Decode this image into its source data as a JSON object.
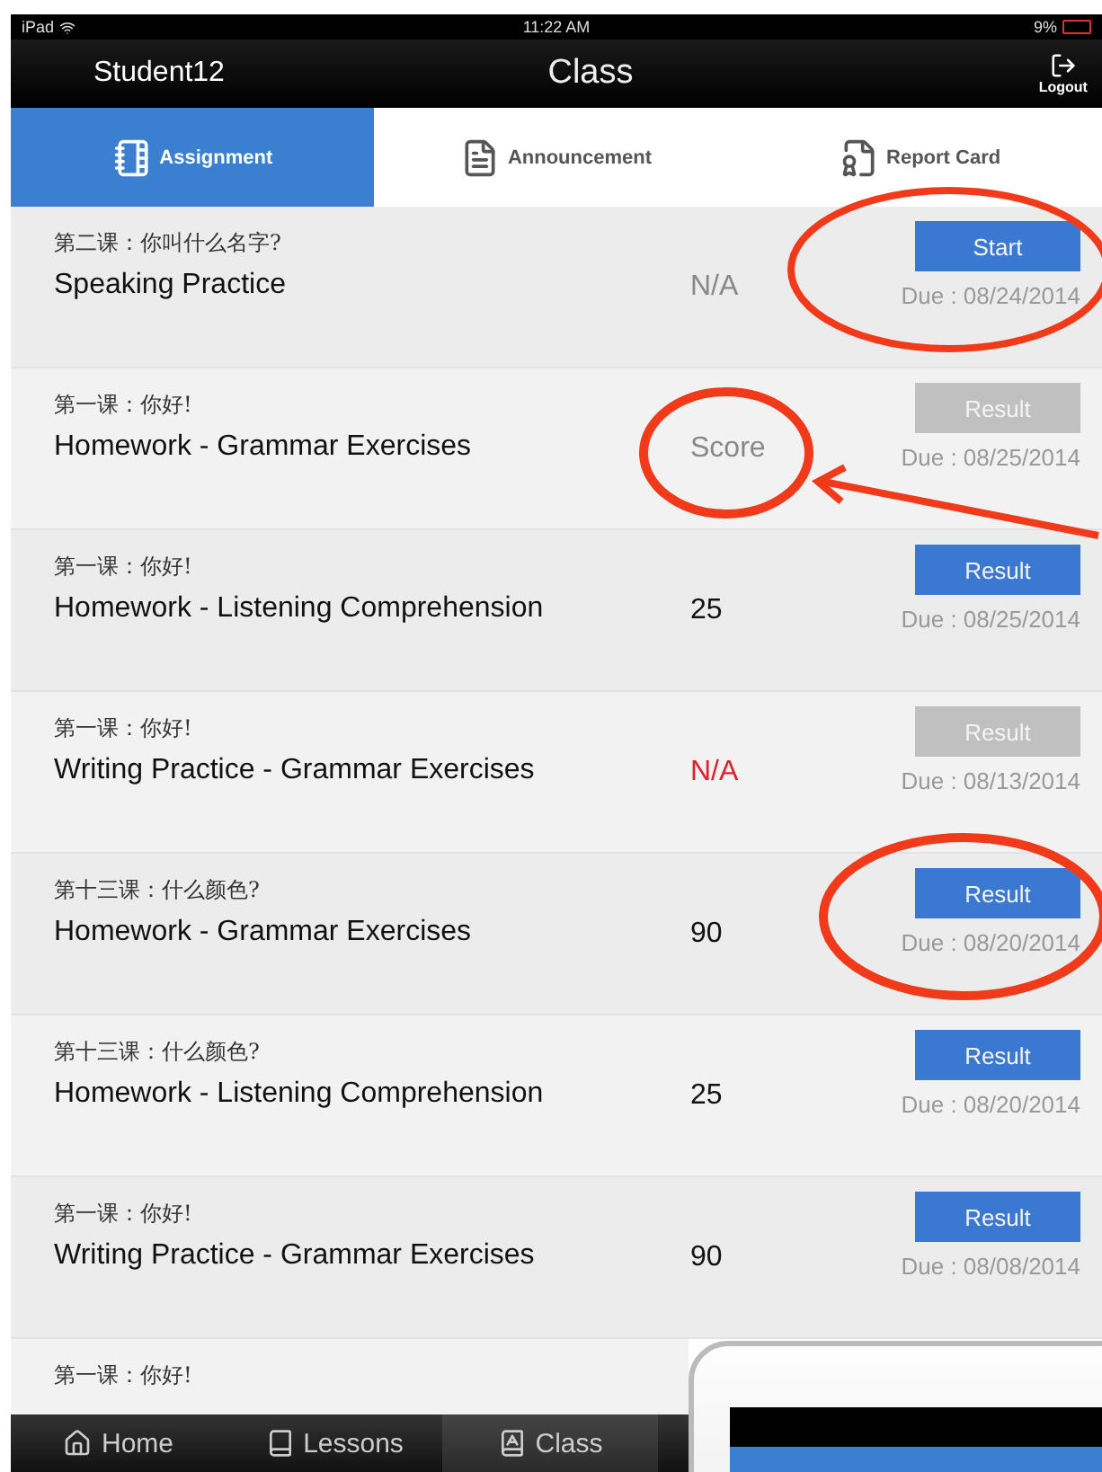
{
  "status_bar": {
    "device": "iPad",
    "time": "11:22 AM",
    "battery": "9%"
  },
  "nav_bar": {
    "user": "Student12",
    "title": "Class",
    "logout": "Logout"
  },
  "tabs": [
    {
      "label": "Assignment",
      "selected": true,
      "kind": "notebook"
    },
    {
      "label": "Announcement",
      "selected": false,
      "kind": "document"
    },
    {
      "label": "Report Card",
      "selected": false,
      "kind": "report"
    }
  ],
  "assignments": [
    {
      "lesson": "第二课：你叫什么名字?",
      "title": "Speaking Practice",
      "score": {
        "text": "N/A",
        "kind": "muted"
      },
      "button": {
        "label": "Start",
        "enabled": true
      },
      "due": "Due : 08/24/2014"
    },
    {
      "lesson": "第一课：你好!",
      "title": "Homework - Grammar Exercises",
      "score": {
        "text": "Score",
        "kind": "muted"
      },
      "button": {
        "label": "Result",
        "enabled": false
      },
      "due": "Due : 08/25/2014"
    },
    {
      "lesson": "第一课：你好!",
      "title": "Homework - Listening Comprehension",
      "score": {
        "text": "25",
        "kind": "normal"
      },
      "button": {
        "label": "Result",
        "enabled": true
      },
      "due": "Due : 08/25/2014"
    },
    {
      "lesson": "第一课：你好!",
      "title": "Writing Practice - Grammar Exercises",
      "score": {
        "text": "N/A",
        "kind": "alert"
      },
      "button": {
        "label": "Result",
        "enabled": false
      },
      "due": "Due : 08/13/2014"
    },
    {
      "lesson": "第十三课：什么颜色?",
      "title": "Homework - Grammar Exercises",
      "score": {
        "text": "90",
        "kind": "normal"
      },
      "button": {
        "label": "Result",
        "enabled": true
      },
      "due": "Due : 08/20/2014"
    },
    {
      "lesson": "第十三课：什么颜色?",
      "title": "Homework - Listening Comprehension",
      "score": {
        "text": "25",
        "kind": "normal"
      },
      "button": {
        "label": "Result",
        "enabled": true
      },
      "due": "Due : 08/20/2014"
    },
    {
      "lesson": "第一课：你好!",
      "title": "Writing Practice - Grammar Exercises",
      "score": {
        "text": "90",
        "kind": "normal"
      },
      "button": {
        "label": "Result",
        "enabled": true
      },
      "due": "Due : 08/08/2014"
    },
    {
      "lesson": "第一课：你好!"
    }
  ],
  "bottom_tabs": [
    {
      "label": "Home",
      "selected": false,
      "kind": "home"
    },
    {
      "label": "Lessons",
      "selected": false,
      "kind": "lessons"
    },
    {
      "label": "Class",
      "selected": true,
      "kind": "class"
    }
  ]
}
